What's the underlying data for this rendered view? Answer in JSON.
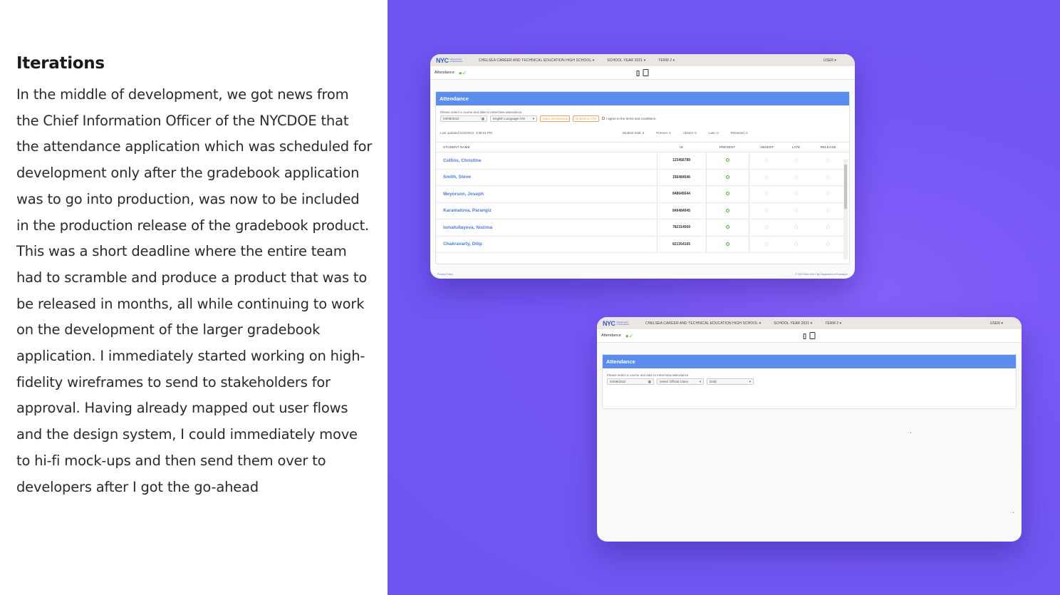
{
  "heading": "Iterations",
  "body_text": "In the middle of development, we got news from the Chief Information Officer of the NYCDOE that the attendance application which was scheduled for development only after the gradebook application was to go into production, was now to be included in the production release of the gradebook product. This was a short deadline where the entire team had to scramble and produce a product that was to be released in months, all while continuing to work on the development of the larger gradebook application. I immediately started working on high-fidelity wireframes to send to stakeholders for approval. Having already mapped out user flows and the design system, I could immediately move to hi-fi mock-ups and then send them over to developers after I got the go-ahead",
  "app": {
    "logo": "NYC",
    "logo_sub": "Department of Education",
    "school": "CHELSEA CAREER AND TECHNICAL EDUCATION HIGH SCHOOL ▾",
    "year": "SCHOOL YEAR 2021 ▾",
    "term": "TERM 2 ▾",
    "user": "USER ▾",
    "section": "Attendance",
    "card_title": "Attendance",
    "instruction": "Please select a course and date to enter/view attendance.",
    "footer_left": "Privacy Policy",
    "footer_right": "© 2022 New York City Department of Education"
  },
  "screen1": {
    "date": "03/08/2022",
    "course": "English Language Arts",
    "mark_all": "Mark all released",
    "submit": "Submit to ATS",
    "agree": "I agree to the terms and conditions.",
    "last_updated": "Last updated 5/10/2022, 4:58:01 PM",
    "stats": [
      "Student total: 6",
      "Present: 6",
      "Absent: 0",
      "Late: 0",
      "Released: 0"
    ],
    "columns": [
      "STUDENT NAME",
      "ID",
      "PRESENT",
      "ABSENT",
      "LATE",
      "RELEASE"
    ],
    "rows": [
      {
        "name": "Collins, Christine",
        "id": "123456789"
      },
      {
        "name": "Smith, Steve",
        "id": "156484546"
      },
      {
        "name": "Meyorson, Joseph",
        "id": "848645644"
      },
      {
        "name": "Karamatova, Parangiz",
        "id": "849484945"
      },
      {
        "name": "Ismatullayeva, Nozima",
        "id": "782314569"
      },
      {
        "name": "Chakravarty, Dilip",
        "id": "821354165"
      }
    ]
  },
  "screen2": {
    "date": "03/08/2022",
    "official_class": "Select Official Class",
    "frequency": "Daily"
  }
}
